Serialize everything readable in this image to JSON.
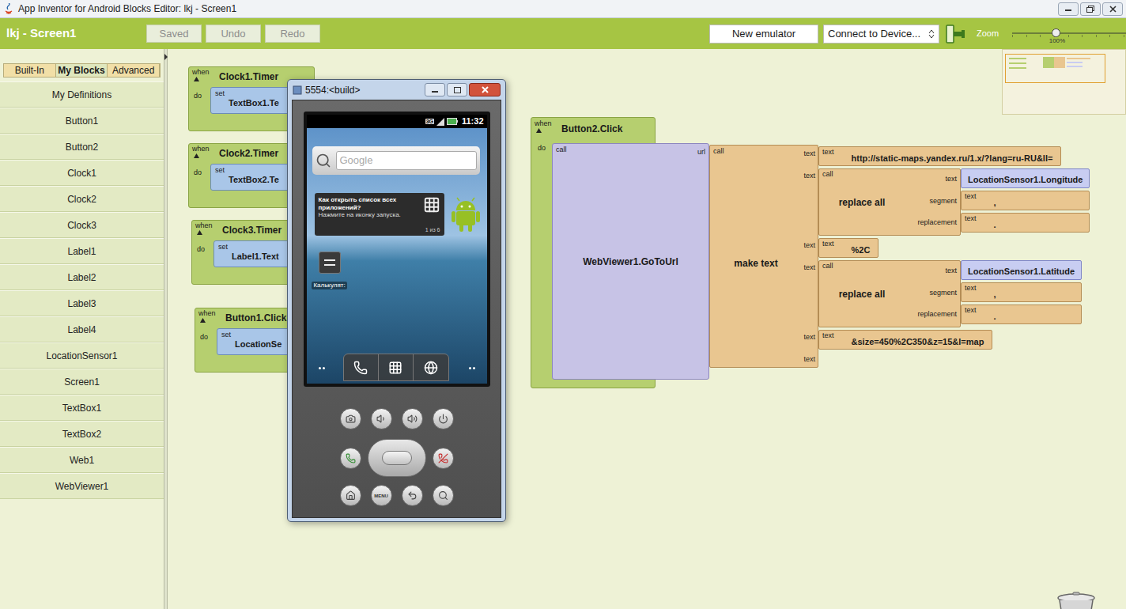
{
  "window": {
    "title": "App Inventor for Android Blocks Editor: lkj - Screen1"
  },
  "toolbar": {
    "project": "lkj - Screen1",
    "buttons": [
      {
        "label": "Saved",
        "disabled": true
      },
      {
        "label": "Undo",
        "disabled": true
      },
      {
        "label": "Redo",
        "disabled": true
      }
    ],
    "new_emulator": "New emulator",
    "connect": "Connect to Device...",
    "zoom": {
      "label": "Zoom",
      "value": "100%",
      "level": 0.38
    }
  },
  "sidebar": {
    "tabs": [
      {
        "label": "Built-In",
        "selected": false
      },
      {
        "label": "My Blocks",
        "selected": true
      },
      {
        "label": "Advanced",
        "selected": false
      }
    ],
    "items": [
      "My Definitions",
      "Button1",
      "Button2",
      "Clock1",
      "Clock2",
      "Clock3",
      "Label1",
      "Label2",
      "Label3",
      "Label4",
      "LocationSensor1",
      "Screen1",
      "TextBox1",
      "TextBox2",
      "Web1",
      "WebViewer1"
    ]
  },
  "event_blocks": [
    {
      "when": "when",
      "event": "Clock1.Timer",
      "do": "do",
      "set": "set",
      "target": "TextBox1.Te"
    },
    {
      "when": "when",
      "event": "Clock2.Timer",
      "do": "do",
      "set": "set",
      "target": "TextBox2.Te"
    },
    {
      "when": "when",
      "event": "Clock3.Timer",
      "do": "do",
      "set": "set",
      "target": "Label1.Text"
    },
    {
      "when": "when",
      "event": "Button1.Click",
      "do": "do",
      "set": "set",
      "target": "LocationSe"
    }
  ],
  "main_block": {
    "when": "when",
    "event": "Button2.Click",
    "do": "do",
    "call": {
      "call": "call",
      "name": "WebViewer1.GoToUrl",
      "socket": "url"
    },
    "make_text": {
      "call": "call",
      "name": "make text",
      "parts": [
        {
          "socket": "text",
          "kind": "text",
          "label": "text",
          "value": "http://static-maps.yandex.ru/1.x/?lang=ru-RU&ll="
        },
        {
          "socket": "text",
          "kind": "replace",
          "call": "call",
          "name": "replace all",
          "args": [
            {
              "socket": "text",
              "kind": "getter",
              "value": "LocationSensor1.Longitude"
            },
            {
              "socket": "segment",
              "kind": "text",
              "label": "text",
              "value": ","
            },
            {
              "socket": "replacement",
              "kind": "text",
              "label": "text",
              "value": "."
            }
          ]
        },
        {
          "socket": "text",
          "kind": "text",
          "label": "text",
          "value": "%2C"
        },
        {
          "socket": "text",
          "kind": "replace",
          "call": "call",
          "name": "replace all",
          "args": [
            {
              "socket": "text",
              "kind": "getter",
              "value": "LocationSensor1.Latitude"
            },
            {
              "socket": "segment",
              "kind": "text",
              "label": "text",
              "value": ","
            },
            {
              "socket": "replacement",
              "kind": "text",
              "label": "text",
              "value": "."
            }
          ]
        },
        {
          "socket": "text",
          "kind": "text",
          "label": "text",
          "value": "&size=450%2C350&z=15&l=map"
        },
        {
          "socket": "text",
          "kind": "empty"
        }
      ]
    }
  },
  "emulator": {
    "title": "5554:<build>",
    "network": "3G",
    "time": "11:32",
    "search_placeholder": "Google",
    "tip": {
      "title": "Как открыть список всех приложений?",
      "body": "Нажмите на иконку запуска.",
      "pager": "1 из 6"
    },
    "app_label": "Калькулят:",
    "menu_key": "MENU"
  }
}
